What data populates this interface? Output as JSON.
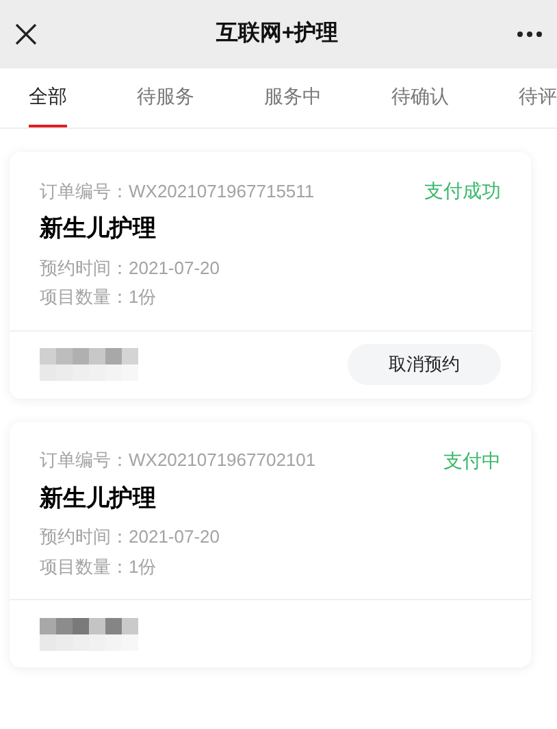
{
  "header": {
    "title": "互联网+护理"
  },
  "tabs": [
    {
      "label": "全部",
      "selected": true
    },
    {
      "label": "待服务",
      "selected": false
    },
    {
      "label": "服务中",
      "selected": false
    },
    {
      "label": "待确认",
      "selected": false
    },
    {
      "label": "待评",
      "selected": false
    }
  ],
  "orders": [
    {
      "order_label": "订单编号：",
      "order_no": "WX2021071967715511",
      "status": "支付成功",
      "title": "新生儿护理",
      "date_label": "预约时间：",
      "date": "2021-07-20",
      "count_label": "项目数量：",
      "count": "1份",
      "button": "取消预约"
    },
    {
      "order_label": "订单编号：",
      "order_no": "WX2021071967702101",
      "status": "支付中",
      "title": "新生儿护理",
      "date_label": "预约时间：",
      "date": "2021-07-20",
      "count_label": "项目数量：",
      "count": "1份"
    }
  ]
}
